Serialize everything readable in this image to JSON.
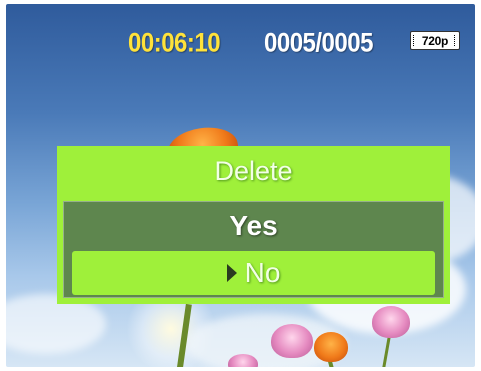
{
  "status_bar": {
    "recording_time": "00:06:10",
    "file_counter": "0005/0005",
    "resolution": "720p"
  },
  "delete_dialog": {
    "title": "Delete",
    "options": [
      {
        "label": "Yes",
        "selected": false
      },
      {
        "label": "No",
        "selected": true
      }
    ],
    "colors": {
      "accent": "#9ff03a",
      "time": "#ffe23a"
    }
  }
}
